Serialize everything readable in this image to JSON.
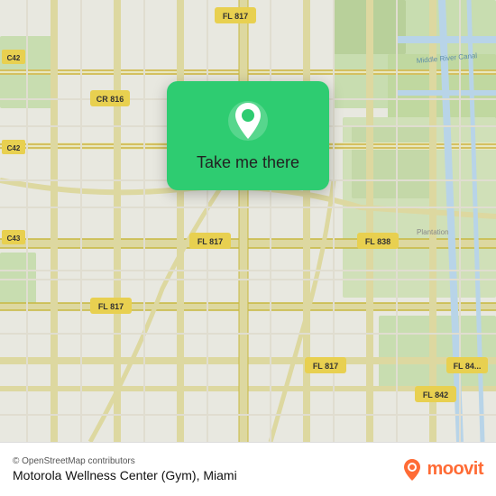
{
  "map": {
    "background_color": "#e8e0d8"
  },
  "card": {
    "button_label": "Take me there",
    "background_color": "#2ecc71"
  },
  "bottom_bar": {
    "attribution": "© OpenStreetMap contributors",
    "location_name": "Motorola Wellness Center (Gym), Miami"
  },
  "moovit": {
    "logo_text": "moovit"
  },
  "icons": {
    "pin": "location-pin-icon",
    "moovit_pin": "moovit-logo-icon"
  }
}
